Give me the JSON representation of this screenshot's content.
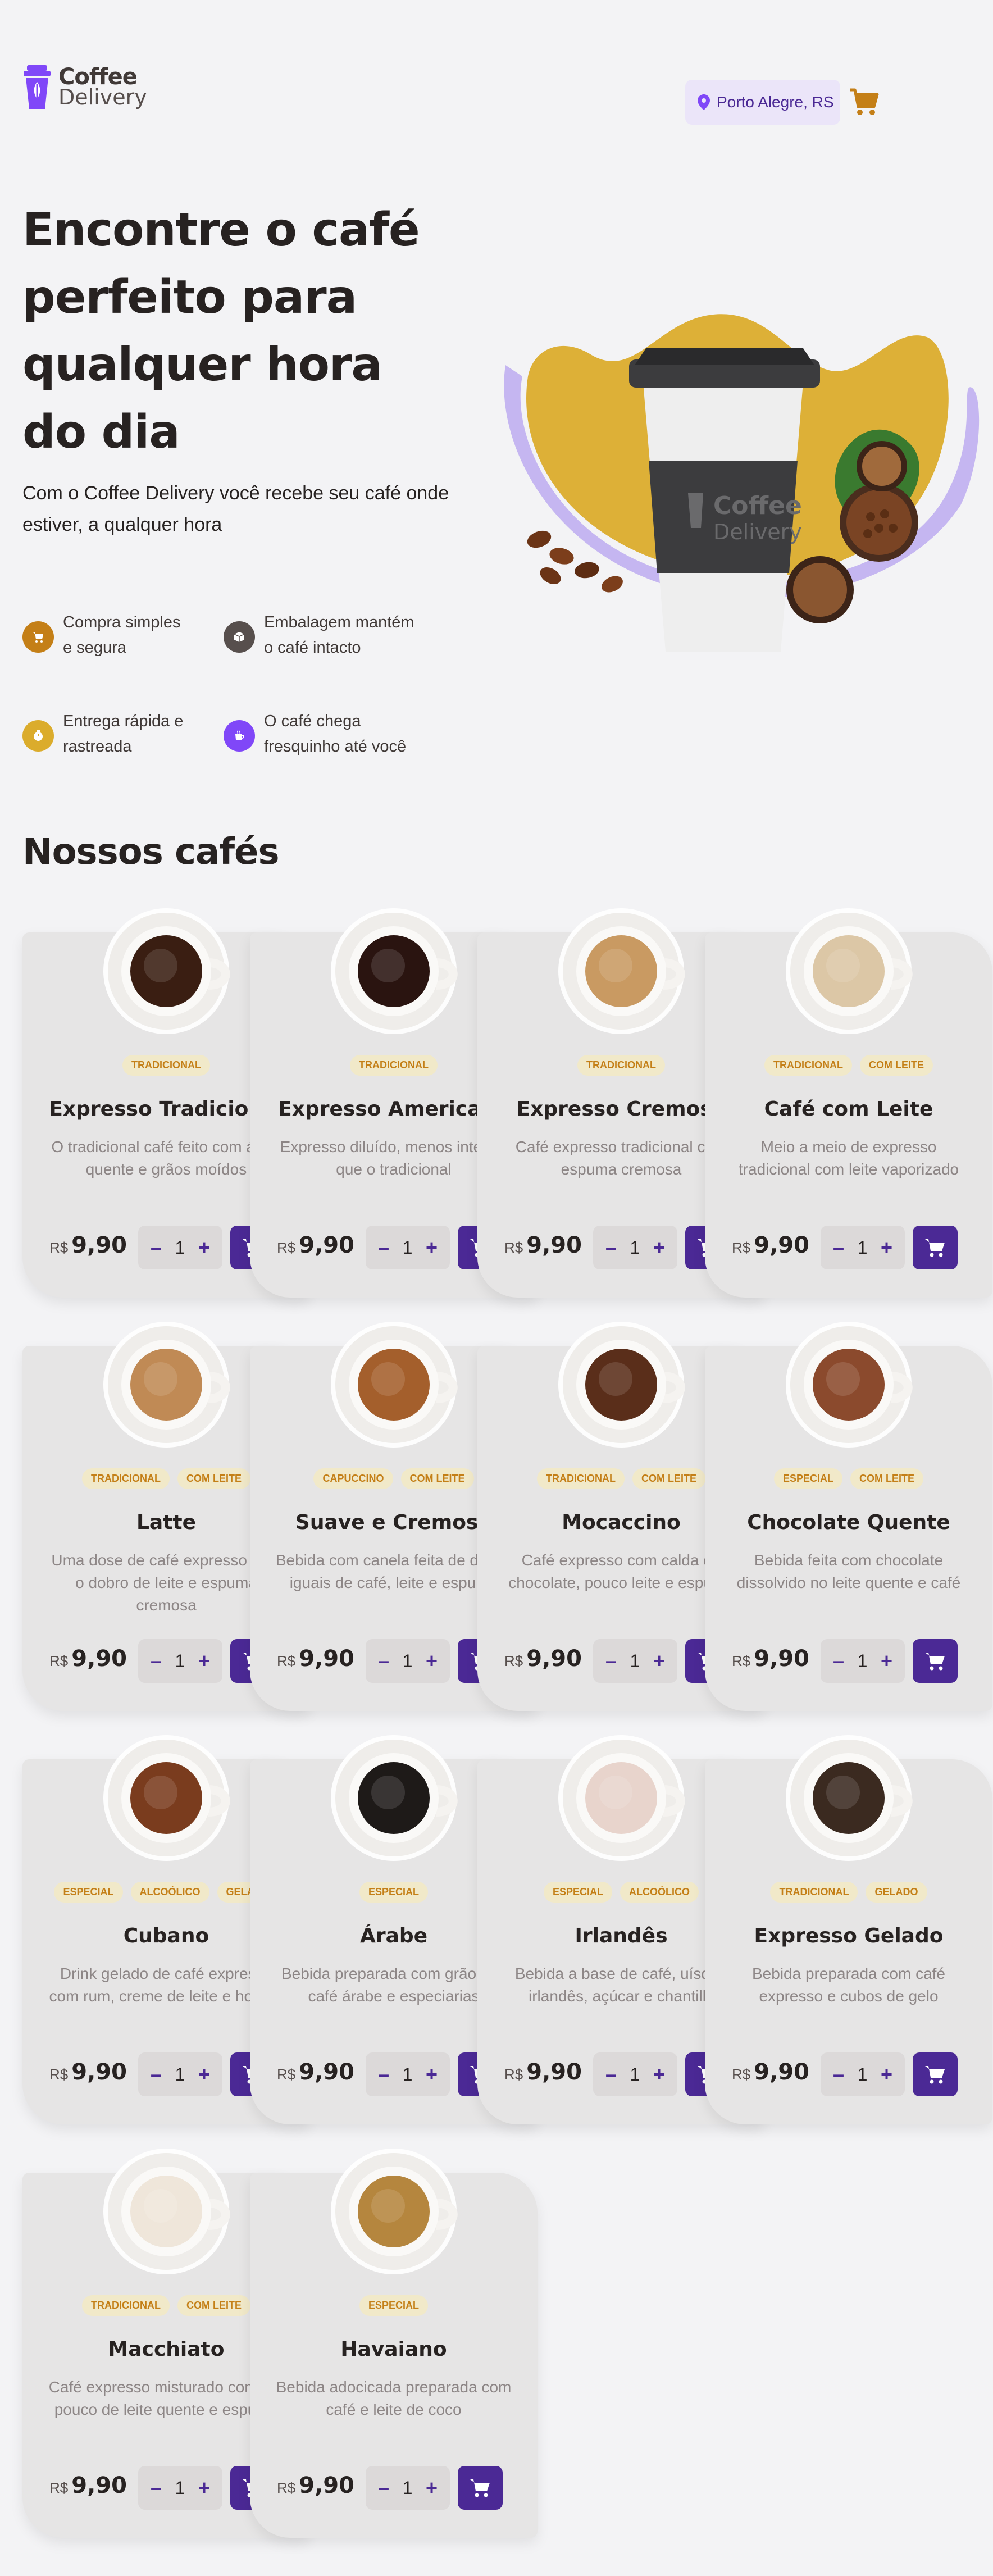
{
  "header": {
    "logo_line1": "Coffee",
    "logo_line2": "Delivery",
    "location": "Porto Alegre, RS"
  },
  "hero": {
    "title": "Encontre o café perfeito para qualquer hora do dia",
    "subtitle": "Com o Coffee Delivery você recebe seu café onde estiver, a qualquer hora",
    "features": [
      {
        "label": "Compra simples e segura",
        "color": "#c47f17",
        "icon": "cart-icon"
      },
      {
        "label": "Embalagem mantém o café intacto",
        "color": "#574f4d",
        "icon": "package-icon"
      },
      {
        "label": "Entrega rápida e rastreada",
        "color": "#dbac2c",
        "icon": "timer-icon"
      },
      {
        "label": "O café chega fresquinho até você",
        "color": "#8047f8",
        "icon": "coffee-icon"
      }
    ]
  },
  "catalog": {
    "title": "Nossos cafés",
    "currency": "R$",
    "items": [
      {
        "name": "Expresso Tradicional",
        "tags": [
          "TRADICIONAL"
        ],
        "description": "O tradicional café feito com água quente e grãos moídos",
        "price": "9,90",
        "quantity": "1",
        "color": "#3a1e12"
      },
      {
        "name": "Expresso Americano",
        "tags": [
          "TRADICIONAL"
        ],
        "description": "Expresso diluído, menos intenso que o tradicional",
        "price": "9,90",
        "quantity": "1",
        "color": "#2a1410"
      },
      {
        "name": "Expresso Cremoso",
        "tags": [
          "TRADICIONAL"
        ],
        "description": "Café expresso tradicional com espuma cremosa",
        "price": "9,90",
        "quantity": "1",
        "color": "#c99a62"
      },
      {
        "name": "Café com Leite",
        "tags": [
          "TRADICIONAL",
          "COM LEITE"
        ],
        "description": "Meio a meio de expresso tradicional com leite vaporizado",
        "price": "9,90",
        "quantity": "1",
        "color": "#dcc7a6"
      },
      {
        "name": "Latte",
        "tags": [
          "TRADICIONAL",
          "COM LEITE"
        ],
        "description": "Uma dose de café expresso com o dobro de leite e espuma cremosa",
        "price": "9,90",
        "quantity": "1",
        "color": "#c08a55"
      },
      {
        "name": "Suave e Cremoso",
        "tags": [
          "CAPUCCINO",
          "COM LEITE"
        ],
        "description": "Bebida com canela feita de doses iguais de café, leite e espuma",
        "price": "9,90",
        "quantity": "1",
        "color": "#a45f2c"
      },
      {
        "name": "Mocaccino",
        "tags": [
          "TRADICIONAL",
          "COM LEITE"
        ],
        "description": "Café expresso com calda de chocolate, pouco leite e espuma",
        "price": "9,90",
        "quantity": "1",
        "color": "#5a2e1a"
      },
      {
        "name": "Chocolate Quente",
        "tags": [
          "ESPECIAL",
          "COM LEITE"
        ],
        "description": "Bebida feita com chocolate dissolvido no leite quente e café",
        "price": "9,90",
        "quantity": "1",
        "color": "#8b4a2d"
      },
      {
        "name": "Cubano",
        "tags": [
          "ESPECIAL",
          "ALCOÓLICO",
          "GELADO"
        ],
        "description": "Drink gelado de café expresso com rum, creme de leite e hortelã",
        "price": "9,90",
        "quantity": "1",
        "color": "#7a3c1e"
      },
      {
        "name": "Árabe",
        "tags": [
          "ESPECIAL"
        ],
        "description": "Bebida preparada com grãos de café árabe e especiarias",
        "price": "9,90",
        "quantity": "1",
        "color": "#1e1a18"
      },
      {
        "name": "Irlandês",
        "tags": [
          "ESPECIAL",
          "ALCOÓLICO"
        ],
        "description": "Bebida a base de café, uísque irlandês, açúcar e chantilly",
        "price": "9,90",
        "quantity": "1",
        "color": "#e8d4cc"
      },
      {
        "name": "Expresso Gelado",
        "tags": [
          "TRADICIONAL",
          "GELADO"
        ],
        "description": "Bebida preparada com café expresso e cubos de gelo",
        "price": "9,90",
        "quantity": "1",
        "color": "#3b2a20"
      },
      {
        "name": "Macchiato",
        "tags": [
          "TRADICIONAL",
          "COM LEITE"
        ],
        "description": "Café expresso misturado com um pouco de leite quente e espuma",
        "price": "9,90",
        "quantity": "1",
        "color": "#efe6da"
      },
      {
        "name": "Havaiano",
        "tags": [
          "ESPECIAL"
        ],
        "description": "Bebida adocicada preparada com café e leite de coco",
        "price": "9,90",
        "quantity": "1",
        "color": "#b5863e"
      }
    ]
  }
}
